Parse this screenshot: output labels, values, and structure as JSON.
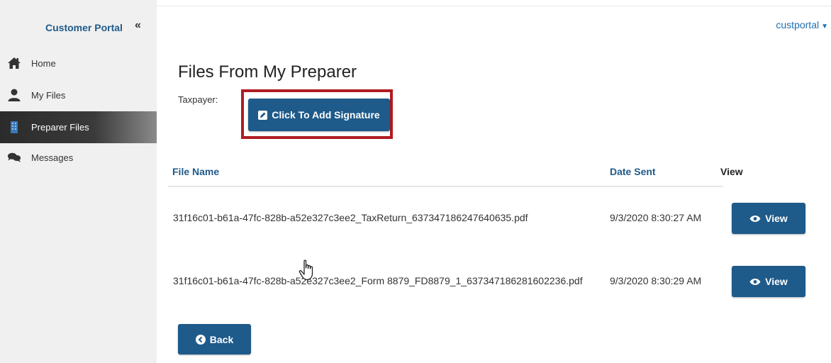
{
  "sidebar": {
    "brand": "Customer Portal",
    "collapse_label": "«",
    "items": [
      {
        "label": "Home",
        "icon": "home-icon"
      },
      {
        "label": "My Files",
        "icon": "user-icon"
      },
      {
        "label": "Preparer Files",
        "icon": "building-icon",
        "active": true
      },
      {
        "label": "Messages",
        "icon": "chat-icon"
      }
    ]
  },
  "header": {
    "user": "custportal"
  },
  "main": {
    "title": "Files From My Preparer",
    "taxpayer_label": "Taxpayer:",
    "signature_button": "Click To Add Signature",
    "table": {
      "columns": [
        "File Name",
        "Date Sent",
        "View"
      ],
      "rows": [
        {
          "file": "31f16c01-b61a-47fc-828b-a52e327c3ee2_TaxReturn_637347186247640635.pdf",
          "date": "9/3/2020 8:30:27 AM",
          "action": "View"
        },
        {
          "file": "31f16c01-b61a-47fc-828b-a52e327c3ee2_Form 8879_FD8879_1_637347186281602236.pdf",
          "date": "9/3/2020 8:30:29 AM",
          "action": "View"
        }
      ]
    },
    "back_button": "Back"
  },
  "colors": {
    "primary": "#1e5a8a",
    "highlight": "#b01c22",
    "link": "#1e6fb0"
  }
}
